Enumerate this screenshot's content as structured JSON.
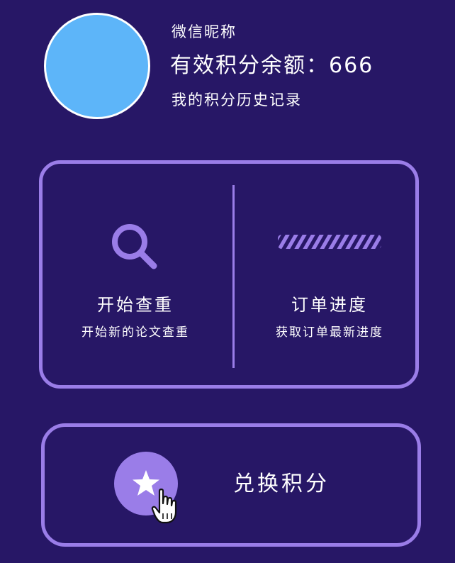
{
  "profile": {
    "nickname": "微信昵称",
    "points_label": "有效积分余额：",
    "points_value": "666",
    "history_link": "我的积分历史记录"
  },
  "actions": {
    "check": {
      "icon": "search-icon",
      "title": "开始查重",
      "subtitle": "开始新的论文查重"
    },
    "order": {
      "icon": "progress-bar-icon",
      "title": "订单进度",
      "subtitle": "获取订单最新进度"
    }
  },
  "exchange": {
    "icon": "star-icon",
    "label": "兑换积分"
  },
  "colors": {
    "background": "#271766",
    "accent": "#9a7de8",
    "avatar": "#5db5f9",
    "text": "#ffffff"
  }
}
